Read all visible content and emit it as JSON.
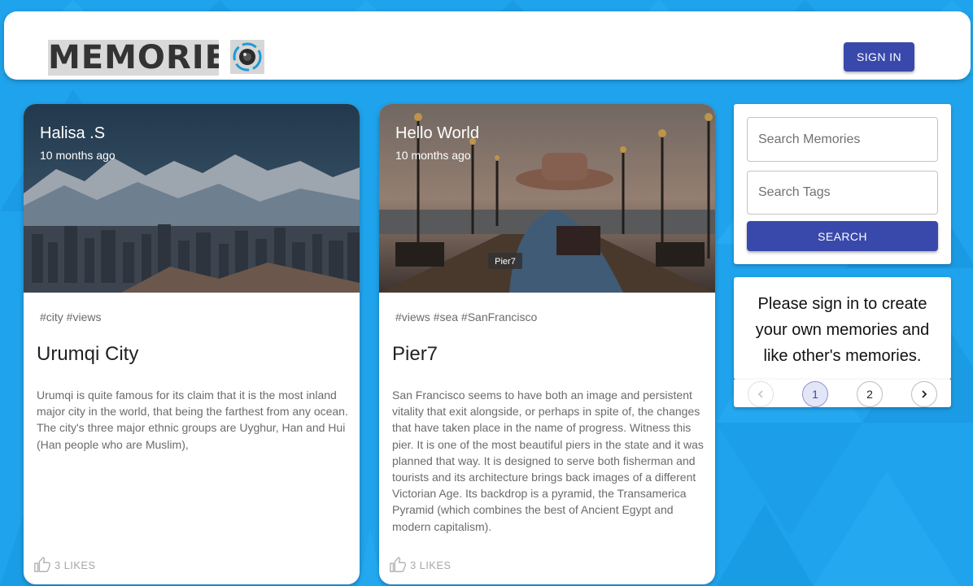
{
  "header": {
    "logo_text": "MEMORIES",
    "sign_in_label": "SIGN IN"
  },
  "posts": [
    {
      "author": "Halisa .S",
      "time": "10 months ago",
      "tags": "#city #views",
      "title": "Urumqi City",
      "message": "Urumqi is quite famous for its claim that it is the most inland major city in the world, that being the farthest from any ocean. The city's three major ethnic groups are Uyghur, Han and Hui (Han people who are Muslim),",
      "likes": "3 LIKES",
      "image_subject": "snowy mountains above a city skyline"
    },
    {
      "author": "Hello World",
      "time": "10 months ago",
      "tags": "#views #sea #SanFrancisco",
      "title": "Pier7",
      "message": "San Francisco seems to have both an image and persistent vitality that exit alongside, or perhaps in spite of, the changes that have taken place in the name of progress. Witness this pier. It is one of the most beautiful piers in the state and it was planned that way. It is designed to serve both fisherman and tourists and its architecture brings back images of a different Victorian Age. Its backdrop is a pyramid, the Transamerica Pyramid (which combines the best of Ancient Egypt and modern capitalism).",
      "likes": "3 LIKES",
      "image_caption": "Pier7",
      "image_subject": "person in hat on a wooden pier with lamp posts"
    }
  ],
  "search": {
    "memories_placeholder": "Search Memories",
    "tags_placeholder": "Search Tags",
    "button_label": "SEARCH"
  },
  "notice": {
    "text": "Please sign in to create your own memories and like other's memories."
  },
  "pagination": {
    "pages": [
      "1",
      "2"
    ],
    "current_page": 1
  },
  "icons": {
    "logo": "camera-lens-icon",
    "like": "thumb-up-icon",
    "prev": "chevron-left-icon",
    "next": "chevron-right-icon"
  },
  "colors": {
    "primary": "#3949ab",
    "background": "#1fa3ec",
    "card": "#ffffff"
  }
}
